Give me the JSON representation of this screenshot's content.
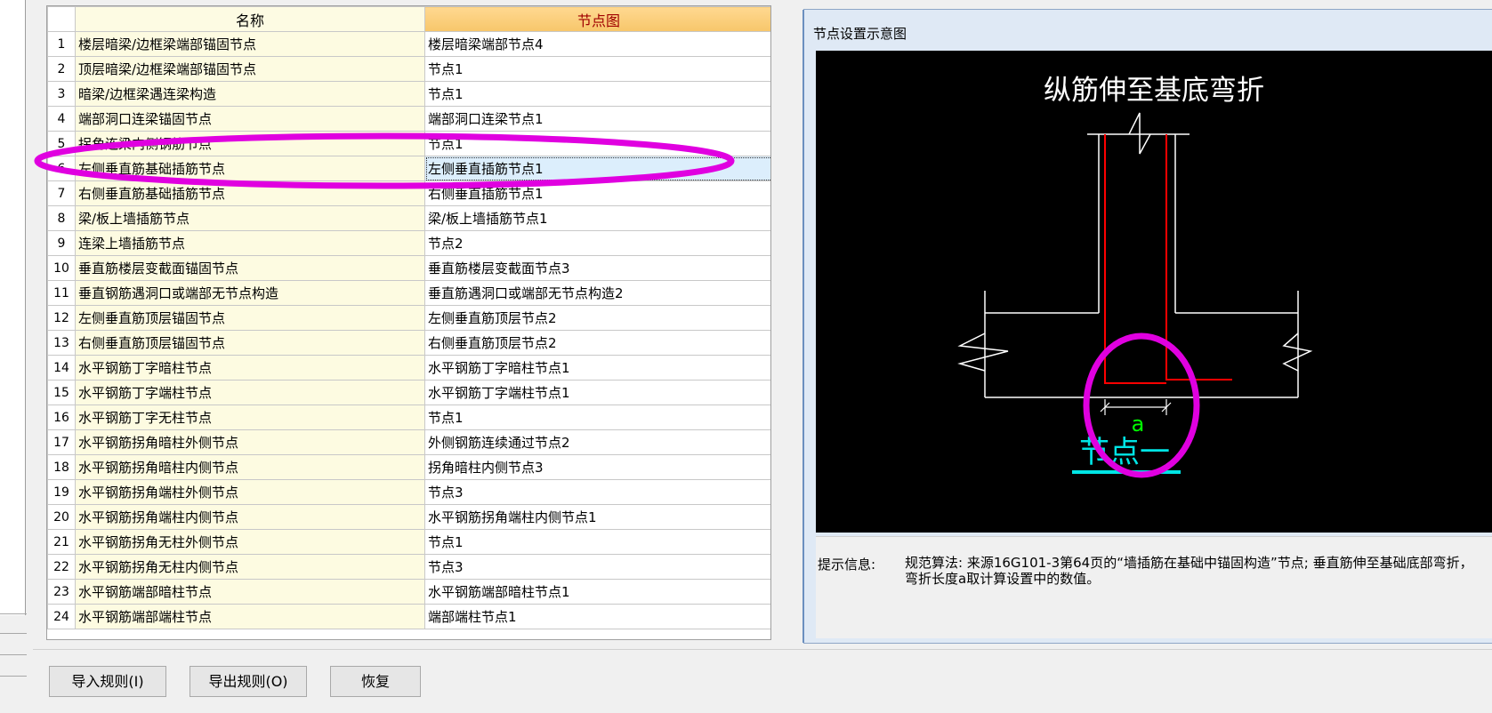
{
  "table": {
    "headers": {
      "name": "名称",
      "node": "节点图"
    },
    "rows": [
      {
        "index": "1",
        "name": "楼层暗梁/边框梁端部锚固节点",
        "node": "楼层暗梁端部节点4"
      },
      {
        "index": "2",
        "name": "顶层暗梁/边框梁端部锚固节点",
        "node": "节点1"
      },
      {
        "index": "3",
        "name": "暗梁/边框梁遇连梁构造",
        "node": "节点1"
      },
      {
        "index": "4",
        "name": "端部洞口连梁锚固节点",
        "node": "端部洞口连梁节点1"
      },
      {
        "index": "5",
        "name": "拐角连梁内侧钢筋节点",
        "node": "节点1"
      },
      {
        "index": "6",
        "name": "左侧垂直筋基础插筋节点",
        "node": "左侧垂直插筋节点1"
      },
      {
        "index": "7",
        "name": "右侧垂直筋基础插筋节点",
        "node": "右侧垂直插筋节点1"
      },
      {
        "index": "8",
        "name": "梁/板上墙插筋节点",
        "node": "梁/板上墙插筋节点1"
      },
      {
        "index": "9",
        "name": "连梁上墙插筋节点",
        "node": "节点2"
      },
      {
        "index": "10",
        "name": "垂直筋楼层变截面锚固节点",
        "node": "垂直筋楼层变截面节点3"
      },
      {
        "index": "11",
        "name": "垂直钢筋遇洞口或端部无节点构造",
        "node": "垂直筋遇洞口或端部无节点构造2"
      },
      {
        "index": "12",
        "name": "左侧垂直筋顶层锚固节点",
        "node": "左侧垂直筋顶层节点2"
      },
      {
        "index": "13",
        "name": "右侧垂直筋顶层锚固节点",
        "node": "右侧垂直筋顶层节点2"
      },
      {
        "index": "14",
        "name": "水平钢筋丁字暗柱节点",
        "node": "水平钢筋丁字暗柱节点1"
      },
      {
        "index": "15",
        "name": "水平钢筋丁字端柱节点",
        "node": "水平钢筋丁字端柱节点1"
      },
      {
        "index": "16",
        "name": "水平钢筋丁字无柱节点",
        "node": "节点1"
      },
      {
        "index": "17",
        "name": "水平钢筋拐角暗柱外侧节点",
        "node": "外侧钢筋连续通过节点2"
      },
      {
        "index": "18",
        "name": "水平钢筋拐角暗柱内侧节点",
        "node": "拐角暗柱内侧节点3"
      },
      {
        "index": "19",
        "name": "水平钢筋拐角端柱外侧节点",
        "node": "节点3"
      },
      {
        "index": "20",
        "name": "水平钢筋拐角端柱内侧节点",
        "node": "水平钢筋拐角端柱内侧节点1"
      },
      {
        "index": "21",
        "name": "水平钢筋拐角无柱外侧节点",
        "node": "节点1"
      },
      {
        "index": "22",
        "name": "水平钢筋拐角无柱内侧节点",
        "node": "节点3"
      },
      {
        "index": "23",
        "name": "水平钢筋端部暗柱节点",
        "node": "水平钢筋端部暗柱节点1"
      },
      {
        "index": "24",
        "name": "水平钢筋端部端柱节点",
        "node": "端部端柱节点1"
      }
    ]
  },
  "panel": {
    "title": "节点设置示意图",
    "diagram": {
      "heading": "纵筋伸至基底弯折",
      "dimension_label": "a",
      "node_label": "节点一"
    },
    "hint_label": "提示信息:",
    "hint_text": "规范算法: 来源16G101-3第64页的“墙插筋在基础中锚固构造”节点; 垂直筋伸至基础底部弯折，弯折长度a取计算设置中的数值。"
  },
  "buttons": {
    "import": "导入规则(I)",
    "export": "导出规则(O)",
    "restore": "恢复"
  },
  "colors": {
    "name_column_bg": "#fdfbe1",
    "node_header_bg": "#f7c66a",
    "selected_cell_bg": "#dceefc",
    "annotation": "#e000e0",
    "rebar": "#ff0000",
    "dimension_text": "#00ff00",
    "node_label": "#00e5e5"
  }
}
